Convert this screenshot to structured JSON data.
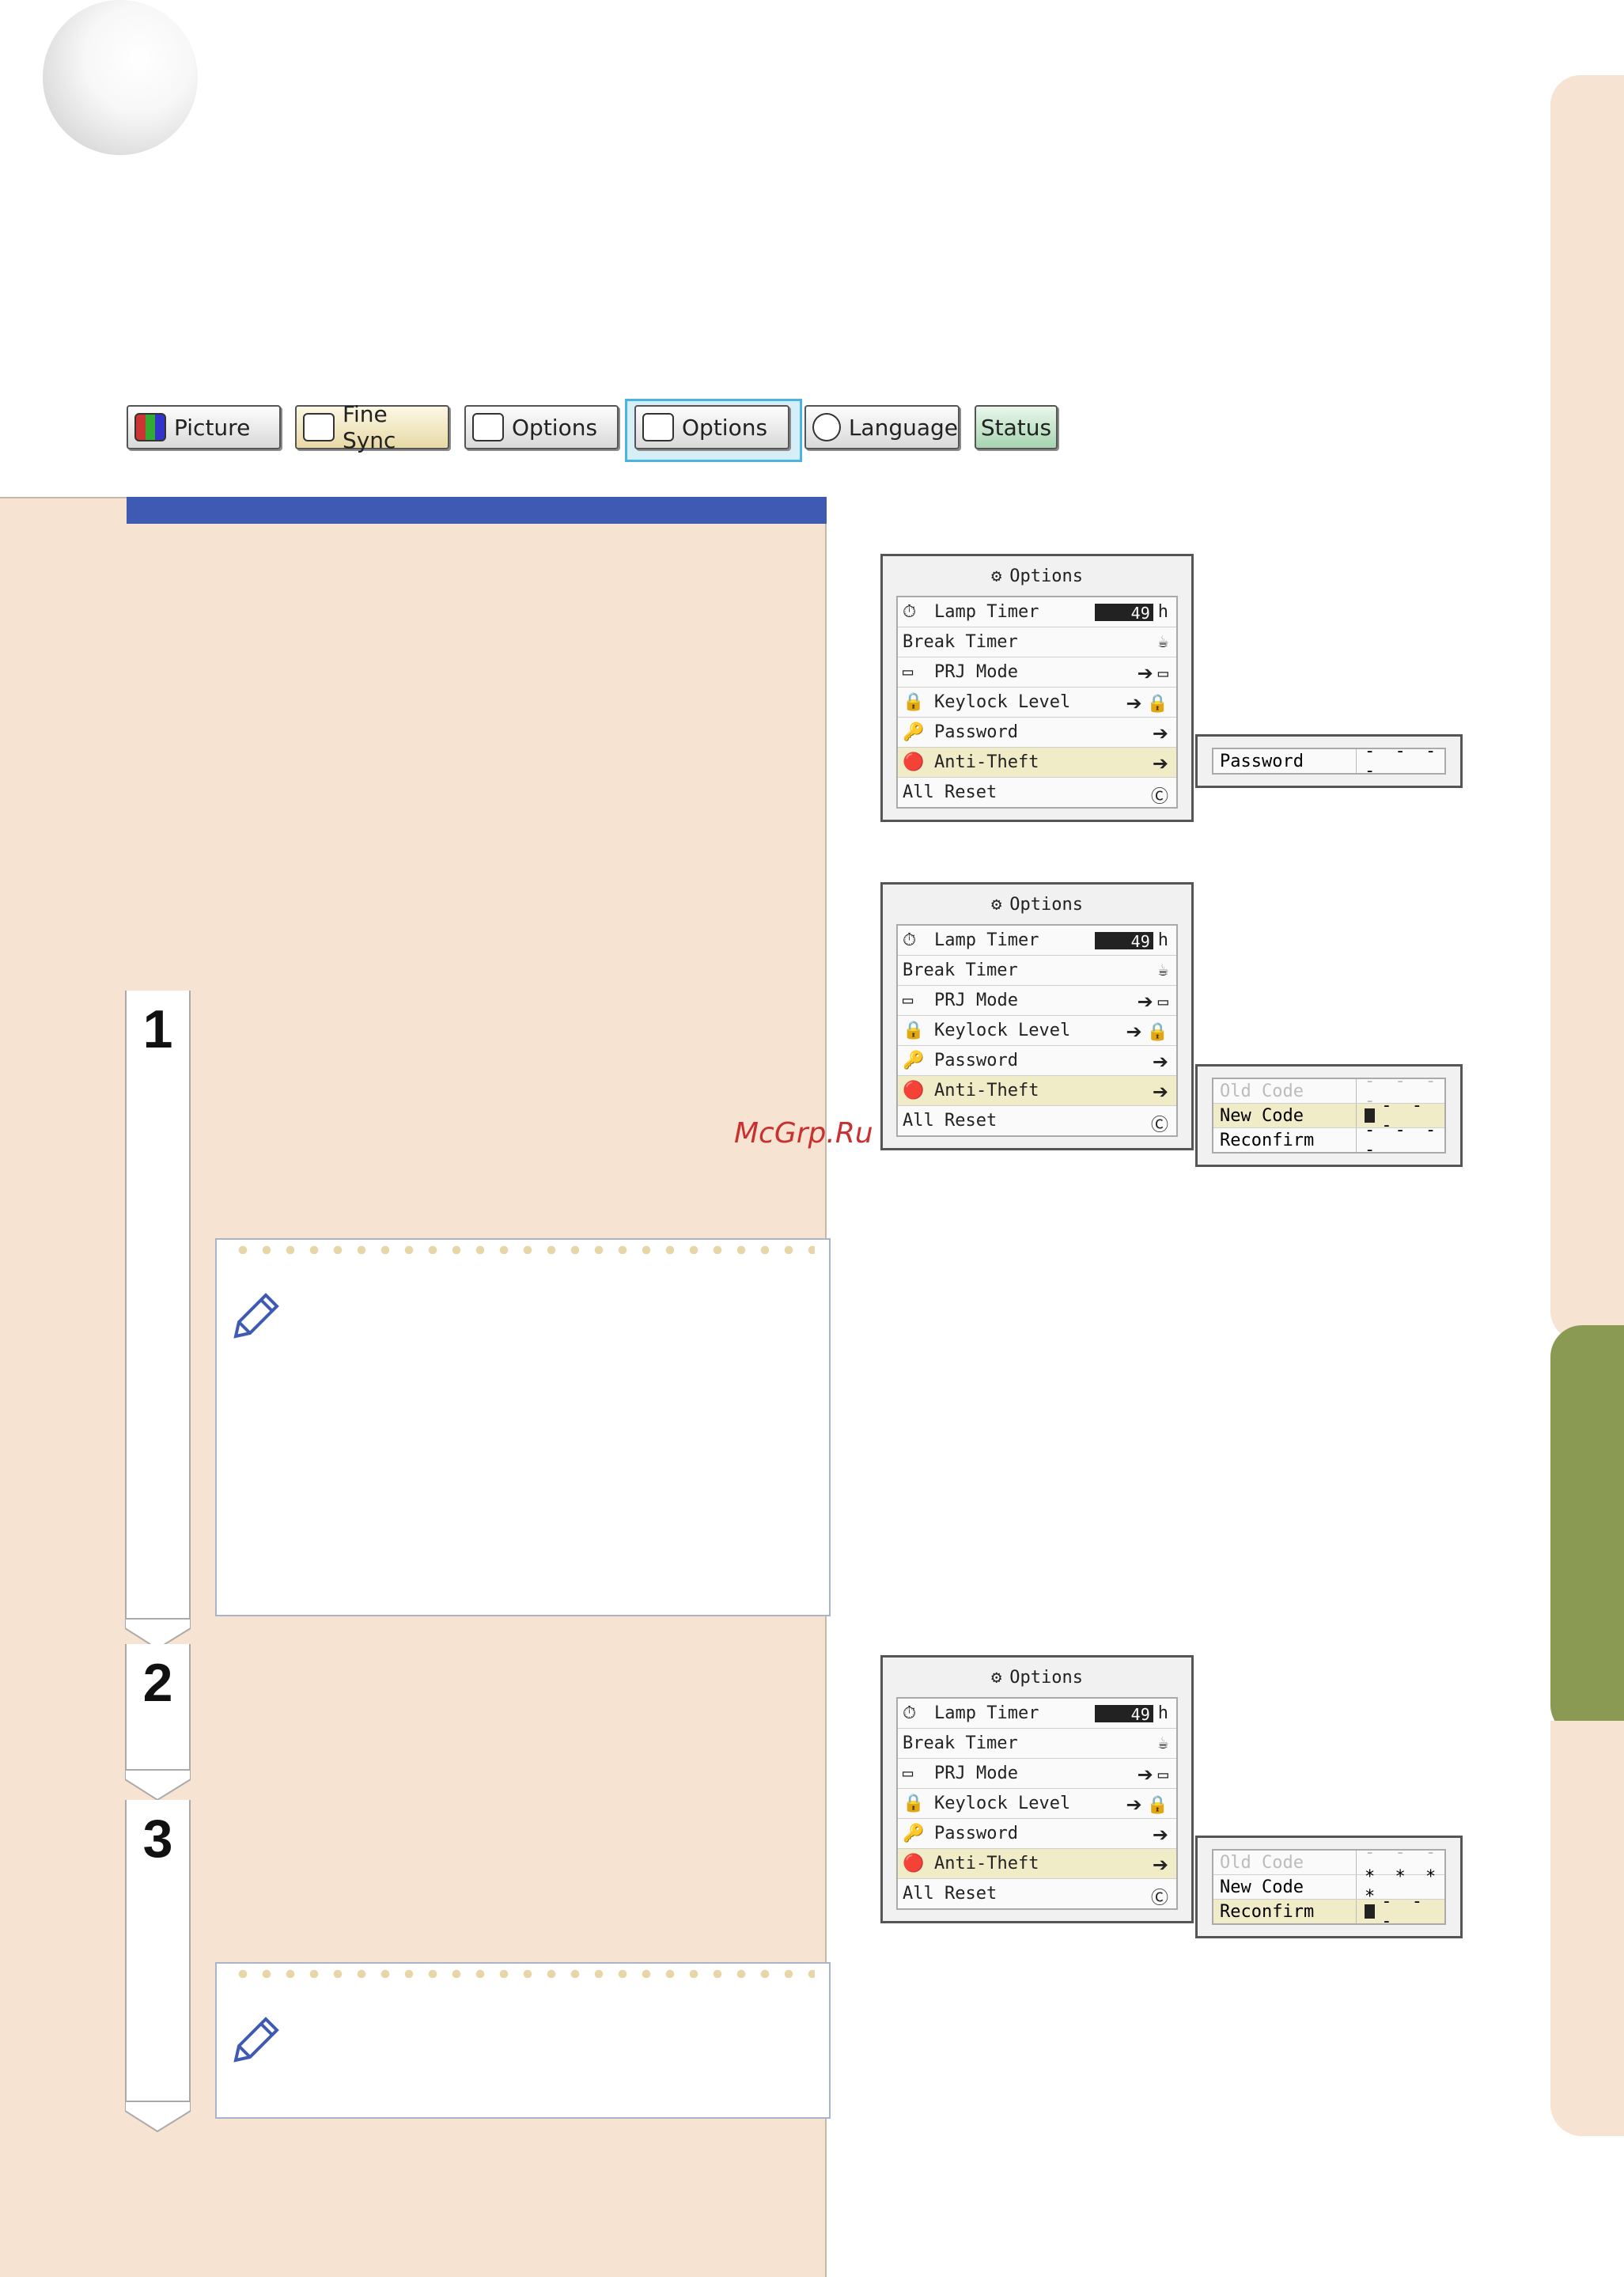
{
  "tabs": [
    {
      "label": "Picture",
      "icon": "picture-icon"
    },
    {
      "label": "Fine Sync",
      "icon": "fine-sync-icon"
    },
    {
      "label": "Options",
      "icon": "options-icon"
    },
    {
      "label": "Options",
      "icon": "options-icon",
      "selected": true
    },
    {
      "label": "Language",
      "icon": "language-icon"
    },
    {
      "label": "Status",
      "icon": ""
    }
  ],
  "steps": [
    "1",
    "2",
    "3"
  ],
  "menu": {
    "title": "Options",
    "items": [
      {
        "label": "Lamp Timer",
        "value": "49",
        "unit": "h"
      },
      {
        "label": "Break Timer"
      },
      {
        "label": "PRJ Mode"
      },
      {
        "label": "Keylock Level"
      },
      {
        "label": "Password"
      },
      {
        "label": "Anti-Theft",
        "highlighted": true
      },
      {
        "label": "All Reset"
      }
    ]
  },
  "popup1": {
    "label": "Password",
    "value": "- - - -"
  },
  "popup2": {
    "rows": [
      {
        "label": "Old Code",
        "value": "- - - -",
        "state": "disabled"
      },
      {
        "label": "New Code",
        "value": "- - -",
        "state": "active"
      },
      {
        "label": "Reconfirm",
        "value": "- - - -",
        "state": "normal"
      }
    ]
  },
  "popup3": {
    "rows": [
      {
        "label": "Old Code",
        "value": "- - - -",
        "state": "disabled"
      },
      {
        "label": "New Code",
        "value": "* * * *",
        "state": "normal"
      },
      {
        "label": "Reconfirm",
        "value": "- - -",
        "state": "active"
      }
    ]
  },
  "watermark": "McGrp.Ru",
  "colors": {
    "panel": "#f6e3d1",
    "bar": "#3f5ab3",
    "sideGreen": "#8b9a52",
    "highlight": "#f1ecc8"
  }
}
